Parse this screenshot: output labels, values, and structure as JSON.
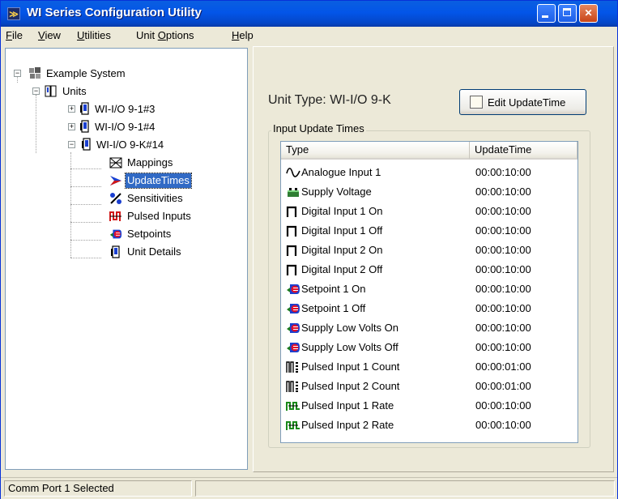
{
  "window": {
    "title": "WI Series Configuration Utility"
  },
  "menu": [
    {
      "label": "File",
      "key": "F",
      "rest": "ile"
    },
    {
      "label": "View",
      "key": "V",
      "rest": "iew"
    },
    {
      "label": "Utilities",
      "key": "U",
      "rest": "tilities"
    },
    {
      "label": "Unit Options",
      "pre": "Unit ",
      "key": "O",
      "rest": "ptions"
    },
    {
      "label": "Help",
      "key": "H",
      "rest": "elp"
    }
  ],
  "tree": {
    "root": "Example System",
    "units": "Units",
    "unit1": "WI-I/O 9-1#3",
    "unit2": "WI-I/O 9-1#4",
    "unit3": "WI-I/O 9-K#14",
    "children": [
      "Mappings",
      "UpdateTimes",
      "Sensitivities",
      "Pulsed Inputs",
      "Setpoints",
      "Unit Details"
    ]
  },
  "panel": {
    "unit_type": "Unit Type:  WI-I/O 9-K",
    "edit_button": "Edit UpdateTime",
    "group_title": "Input Update Times",
    "columns": {
      "type": "Type",
      "time": "UpdateTime"
    },
    "rows": [
      {
        "name": "Analogue Input 1",
        "time": "00:00:10:00",
        "icon": "analogue-wave-icon"
      },
      {
        "name": "Supply Voltage",
        "time": "00:00:10:00",
        "icon": "battery-icon"
      },
      {
        "name": "Digital Input 1 On",
        "time": "00:00:10:00",
        "icon": "digital-pulse-icon"
      },
      {
        "name": "Digital Input 1 Off",
        "time": "00:00:10:00",
        "icon": "digital-pulse-icon"
      },
      {
        "name": "Digital Input 2 On",
        "time": "00:00:10:00",
        "icon": "digital-pulse-icon"
      },
      {
        "name": "Digital Input 2 Off",
        "time": "00:00:10:00",
        "icon": "digital-pulse-icon"
      },
      {
        "name": "Setpoint 1 On",
        "time": "00:00:10:00",
        "icon": "setpoint-icon"
      },
      {
        "name": "Setpoint 1 Off",
        "time": "00:00:10:00",
        "icon": "setpoint-icon"
      },
      {
        "name": "Supply Low Volts On",
        "time": "00:00:10:00",
        "icon": "setpoint-icon"
      },
      {
        "name": "Supply Low Volts Off",
        "time": "00:00:10:00",
        "icon": "setpoint-icon"
      },
      {
        "name": "Pulsed Input 1 Count",
        "time": "00:00:01:00",
        "icon": "pulse-count-icon"
      },
      {
        "name": "Pulsed Input 2 Count",
        "time": "00:00:01:00",
        "icon": "pulse-count-icon"
      },
      {
        "name": "Pulsed Input 1 Rate",
        "time": "00:00:10:00",
        "icon": "pulse-rate-icon"
      },
      {
        "name": "Pulsed Input 2 Rate",
        "time": "00:00:10:00",
        "icon": "pulse-rate-icon"
      }
    ]
  },
  "status": {
    "text": "Comm Port 1 Selected"
  }
}
